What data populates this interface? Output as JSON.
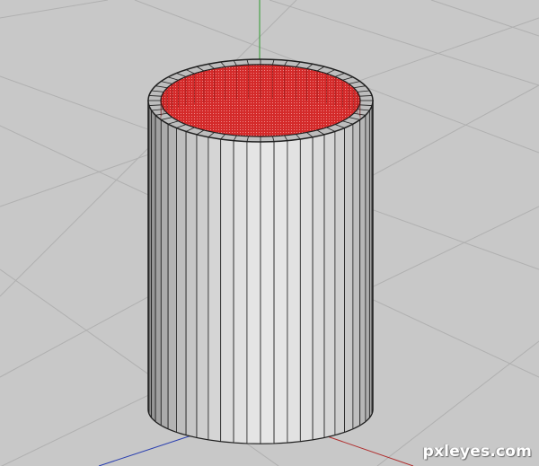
{
  "viewport": {
    "background_color": "#c8c8c8",
    "grid_color": "#b0b0b0",
    "axis_colors": {
      "x": "#b03030",
      "y": "#2e9a2e",
      "z": "#2a3fb0"
    }
  },
  "model": {
    "type": "cylinder",
    "segments": 26,
    "outer_color": "#d3d3d3",
    "edge_color": "#1f1f1f",
    "interior_color": "#d42a2a"
  },
  "watermark": {
    "text": "pxleyes.com"
  }
}
